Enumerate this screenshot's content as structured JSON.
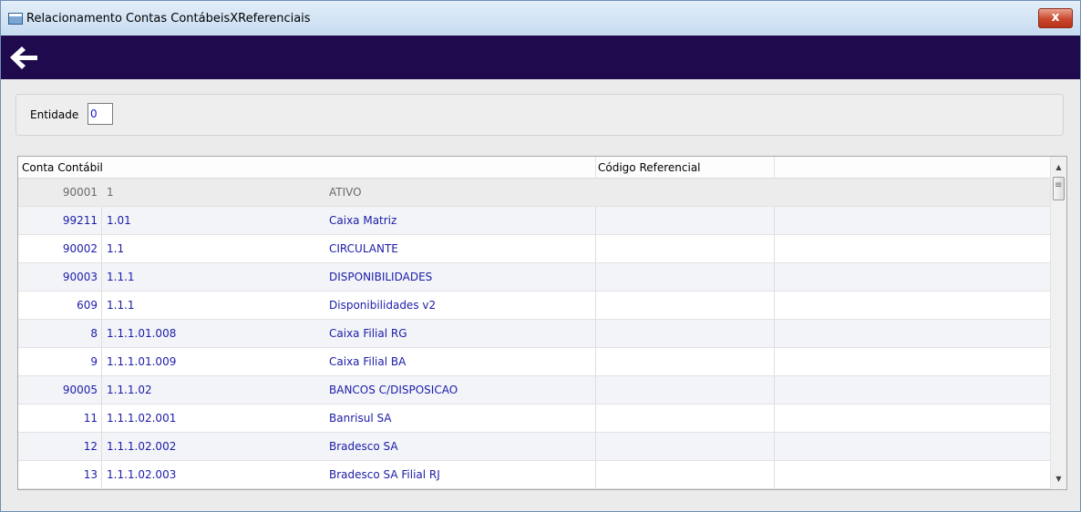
{
  "window": {
    "title": "Relacionamento Contas ContábeisXReferenciais",
    "close_label": "x"
  },
  "toolbar": {
    "back_icon": "arrow-left-icon"
  },
  "filter": {
    "label": "Entidade",
    "value": "0"
  },
  "grid": {
    "columns": [
      "Conta Contábil",
      "Código Referencial"
    ],
    "rows": [
      {
        "id": "90001",
        "code": "1",
        "desc": "ATIVO"
      },
      {
        "id": "99211",
        "code": "1.01",
        "desc": "Caixa Matriz"
      },
      {
        "id": "90002",
        "code": "1.1",
        "desc": "CIRCULANTE"
      },
      {
        "id": "90003",
        "code": "1.1.1",
        "desc": "DISPONIBILIDADES"
      },
      {
        "id": "609",
        "code": "1.1.1",
        "desc": "Disponibilidades v2"
      },
      {
        "id": "8",
        "code": "1.1.1.01.008",
        "desc": "Caixa Filial RG"
      },
      {
        "id": "9",
        "code": "1.1.1.01.009",
        "desc": "Caixa Filial BA"
      },
      {
        "id": "90005",
        "code": "1.1.1.02",
        "desc": "BANCOS C/DISPOSICAO"
      },
      {
        "id": "11",
        "code": "1.1.1.02.001",
        "desc": "Banrisul SA"
      },
      {
        "id": "12",
        "code": "1.1.1.02.002",
        "desc": "Bradesco SA"
      },
      {
        "id": "13",
        "code": "1.1.1.02.003",
        "desc": "Bradesco SA Filial RJ"
      }
    ]
  },
  "colors": {
    "toolbar": "#1e0a4d",
    "row_text": "#1c1ca8",
    "selected_row_text": "#6b6b6b"
  }
}
